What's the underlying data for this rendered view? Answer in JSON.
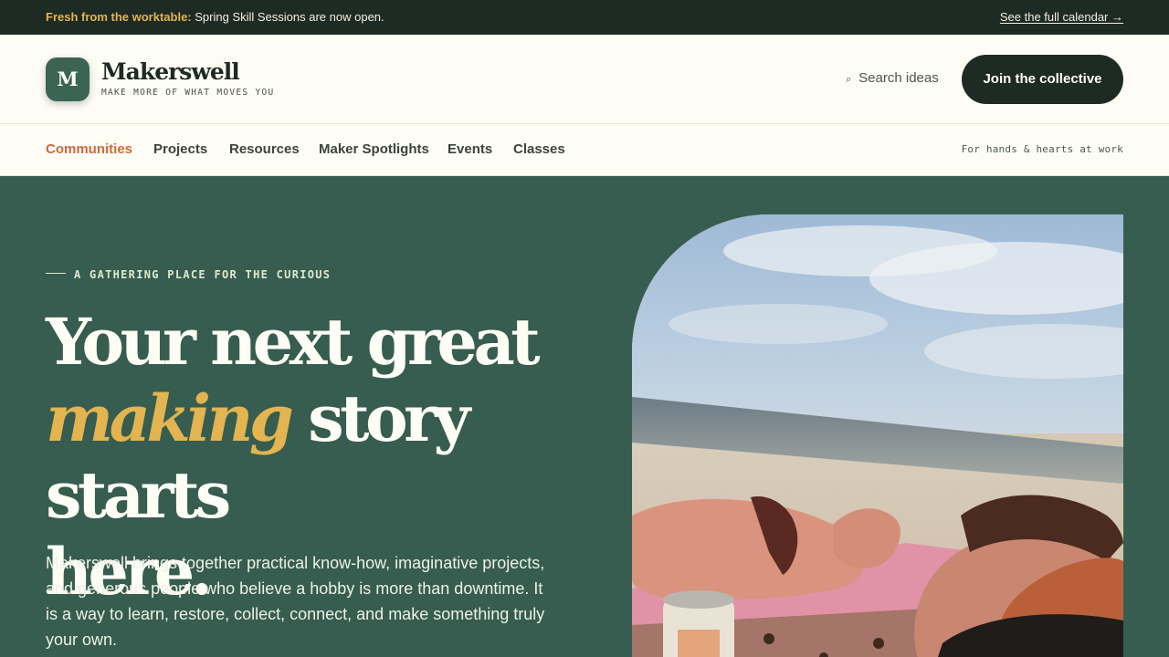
{
  "announcement": {
    "lead": "Fresh from the worktable:",
    "text": " Spring Skill Sessions are now open.",
    "link_label": "See the full calendar →"
  },
  "header": {
    "logo_letter": "M",
    "brand_name": "Makerswell",
    "tagline": "MAKE MORE OF WHAT MOVES YOU",
    "search_icon": "⌕",
    "search_label": "Search ideas",
    "join_label": "Join the collective"
  },
  "nav": {
    "items": [
      {
        "label": "Communities",
        "active": true
      },
      {
        "label": "Projects"
      },
      {
        "label": "Resources"
      },
      {
        "label": "Maker Spotlights"
      },
      {
        "label": "Events"
      },
      {
        "label": "Classes"
      }
    ],
    "note": "For hands & hearts at work"
  },
  "hero": {
    "eyebrow": "A GATHERING PLACE FOR THE CURIOUS",
    "headline_1": "Your next great",
    "headline_accent": "making",
    "headline_2": " story starts",
    "headline_3": "here.",
    "body": "Makerswell brings together practical know-how, imaginative projects, and generous people who believe a hobby is more than downtime. It is a way to learn, restore, collect, connect, and make something truly your own."
  },
  "colors": {
    "topbar": "#1e2b24",
    "accent_gold": "#e3b44f",
    "accent_orange": "#cf6a3a",
    "hero_green": "#365d4f",
    "cream": "#fdfcf5"
  },
  "icons": {
    "search": "search-icon"
  }
}
